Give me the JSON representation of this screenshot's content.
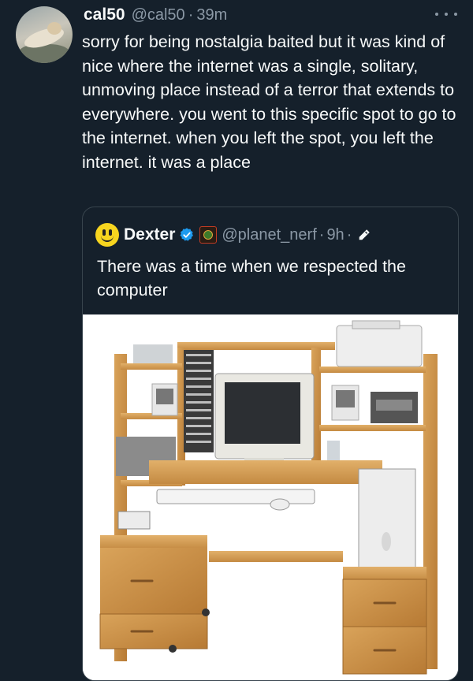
{
  "tweet": {
    "author": {
      "display_name": "cal50",
      "handle": "@cal50",
      "separator": "·",
      "time": "39m"
    },
    "more_icon": "more-horizontal-icon",
    "text": "sorry for being nostalgia baited but it was kind of nice where the internet was a single, solitary, unmoving place instead of a terror that extends to everywhere. you went to this specific spot to go to the internet.  when you left the spot, you left the internet. it was a place"
  },
  "quote": {
    "author": {
      "display_name": "Dexter",
      "handle": "@planet_nerf",
      "separator": "·",
      "time": "9h",
      "trailing_separator": "·"
    },
    "verified_icon": "verified-badge-icon",
    "edit_icon": "pencil-icon",
    "text": "There was a time when we respected the computer",
    "media": {
      "description_icon": "computer-desk-photo"
    }
  },
  "colors": {
    "background": "#15202b",
    "text": "#f7f9f9",
    "muted": "#8b98a5",
    "border": "#38444d",
    "verified": "#1d9bf0"
  }
}
